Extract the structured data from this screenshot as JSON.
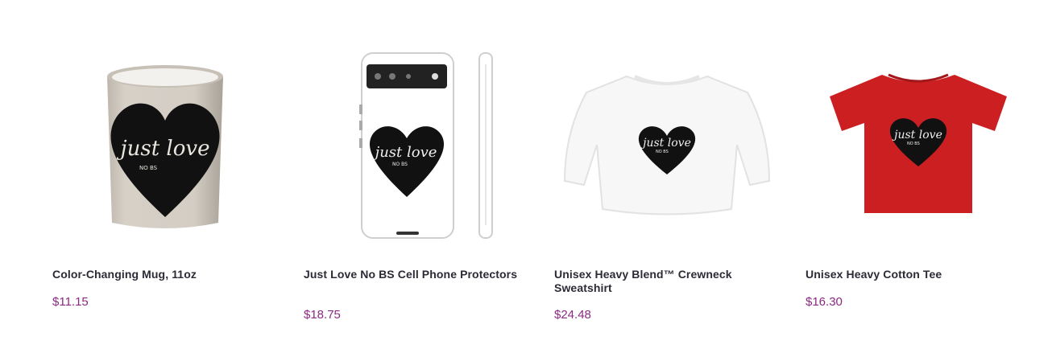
{
  "products": [
    {
      "title": "Color-Changing Mug, 11oz",
      "price": "$11.15",
      "image_icon": "mug-product-image",
      "image_text_main": "just love",
      "image_text_sub": "NO BS"
    },
    {
      "title": "Just Love No BS Cell Phone Protectors",
      "price": "$18.75",
      "image_icon": "phone-case-product-image",
      "image_text_main": "just love",
      "image_text_sub": "NO BS"
    },
    {
      "title": "Unisex Heavy Blend™ Crewneck Sweatshirt",
      "price": "$24.48",
      "image_icon": "sweatshirt-product-image",
      "image_text_main": "just love",
      "image_text_sub": "NO BS"
    },
    {
      "title": "Unisex Heavy Cotton Tee",
      "price": "$16.30",
      "image_icon": "tshirt-product-image",
      "image_text_main": "just love",
      "image_text_sub": "NO BS"
    }
  ],
  "colors": {
    "price": "#8a2a82",
    "title": "#2b2b36",
    "tee": "#cc1f22",
    "heart": "#111111"
  }
}
